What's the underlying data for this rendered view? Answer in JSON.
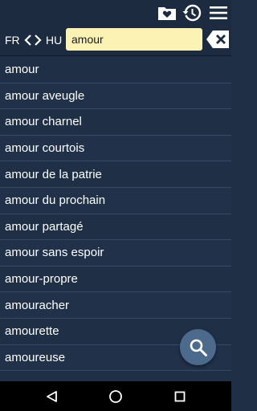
{
  "header": {
    "favorites_icon": "heart-folder-icon",
    "history_icon": "history-icon",
    "menu_icon": "hamburger-menu-icon"
  },
  "lang_bar": {
    "from": "FR",
    "to": "HU",
    "swap_icon": "swap-arrows-icon",
    "search_value": "amour",
    "clear_icon": "backspace-clear-icon"
  },
  "results": [
    "amour",
    "amour aveugle",
    "amour charnel",
    "amour courtois",
    "amour de la patrie",
    "amour du prochain",
    "amour partagé",
    "amour sans espoir",
    "amour-propre",
    "amouracher",
    "amourette",
    "amoureuse"
  ],
  "fab": {
    "icon": "search-icon"
  },
  "nav": {
    "back_icon": "back-icon",
    "home_icon": "home-icon",
    "recents_icon": "recents-icon"
  },
  "colors": {
    "background": "#1f2f45",
    "search_field": "#fcf2b4",
    "fab": "#4b6a8c"
  }
}
